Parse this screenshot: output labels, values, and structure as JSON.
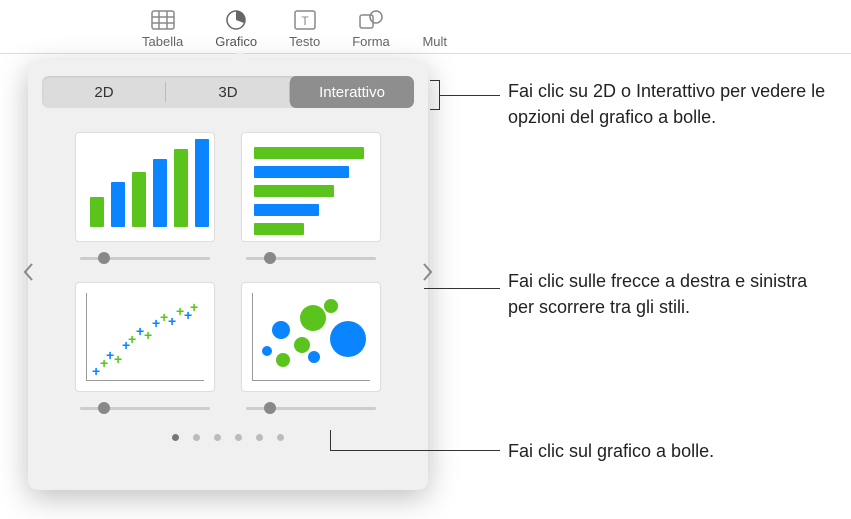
{
  "toolbar": {
    "items": [
      {
        "label": "Tabella",
        "icon": "table-icon"
      },
      {
        "label": "Grafico",
        "icon": "chart-icon"
      },
      {
        "label": "Testo",
        "icon": "text-icon"
      },
      {
        "label": "Forma",
        "icon": "shape-icon"
      },
      {
        "label": "Mult",
        "icon": "media-icon"
      }
    ]
  },
  "popover": {
    "tabs": {
      "t2d": "2D",
      "t3d": "3D",
      "interactive": "Interattivo"
    },
    "page_dots": 6,
    "active_dot": 0
  },
  "callouts": {
    "c1": "Fai clic su 2D o Interattivo per vedere le opzioni del grafico a bolle.",
    "c2": "Fai clic sulle frecce a destra e sinistra per scorrere tra gli stili.",
    "c3": "Fai clic sul grafico a bolle."
  },
  "colors": {
    "green": "#5ac41d",
    "blue": "#0a84ff",
    "darkblue": "#0060c8"
  }
}
